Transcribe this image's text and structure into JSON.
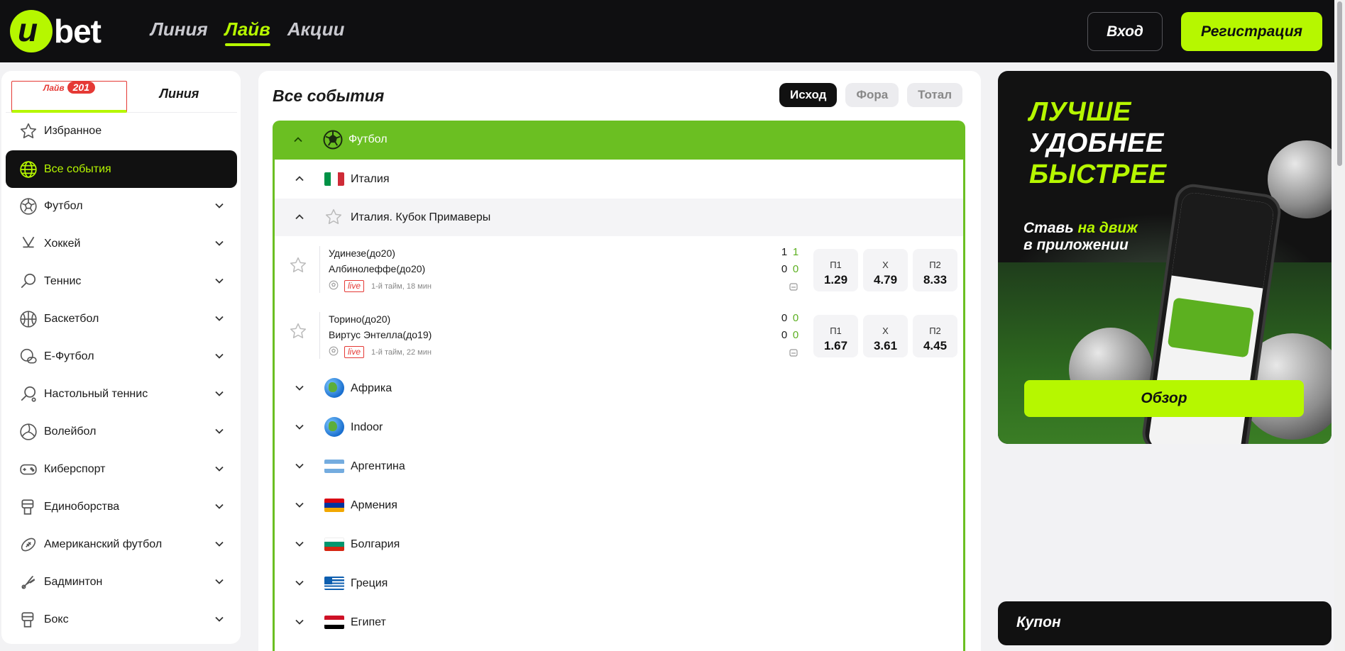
{
  "brand": {
    "logo_u": "u",
    "logo_bet": "bet",
    "accent": "#b6f700"
  },
  "nav": {
    "line": "Линия",
    "live": "Лайв",
    "promos": "Акции"
  },
  "auth": {
    "login": "Вход",
    "register": "Регистрация"
  },
  "sidebar": {
    "tab_live": "Лайв",
    "live_count": "201",
    "tab_line": "Линия",
    "items": [
      {
        "label": "Избранное",
        "icon": "star-icon"
      },
      {
        "label": "Все события",
        "icon": "globe-icon"
      },
      {
        "label": "Футбол",
        "icon": "football-icon"
      },
      {
        "label": "Хоккей",
        "icon": "hockey-icon"
      },
      {
        "label": "Теннис",
        "icon": "tennis-icon"
      },
      {
        "label": "Баскетбол",
        "icon": "basketball-icon"
      },
      {
        "label": "E-Футбол",
        "icon": "efootball-icon"
      },
      {
        "label": "Настольный теннис",
        "icon": "table-tennis-icon"
      },
      {
        "label": "Волейбол",
        "icon": "volleyball-icon"
      },
      {
        "label": "Киберспорт",
        "icon": "gamepad-icon"
      },
      {
        "label": "Единоборства",
        "icon": "martial-arts-icon"
      },
      {
        "label": "Американский футбол",
        "icon": "american-football-icon"
      },
      {
        "label": "Бадминтон",
        "icon": "badminton-icon"
      },
      {
        "label": "Бокс",
        "icon": "boxing-icon"
      }
    ]
  },
  "main": {
    "title": "Все события",
    "tabs": [
      "Исход",
      "Фора",
      "Тотал"
    ],
    "sport": "Футбол",
    "country": "Италия",
    "league": "Италия. Кубок Примаверы",
    "matches": [
      {
        "team1": "Удинезе(до20)",
        "team2": "Албинолеффе(до20)",
        "live": "live",
        "period": "1-й тайм, 18 мин",
        "score1": "1",
        "score1_half": "1",
        "score2": "0",
        "score2_half": "0",
        "odds": [
          {
            "label": "П1",
            "value": "1.29"
          },
          {
            "label": "Х",
            "value": "4.79"
          },
          {
            "label": "П2",
            "value": "8.33"
          }
        ]
      },
      {
        "team1": "Торино(до20)",
        "team2": "Виртус Энтелла(до19)",
        "live": "live",
        "period": "1-й тайм, 22 мин",
        "score1": "0",
        "score1_half": "0",
        "score2": "0",
        "score2_half": "0",
        "odds": [
          {
            "label": "П1",
            "value": "1.67"
          },
          {
            "label": "Х",
            "value": "3.61"
          },
          {
            "label": "П2",
            "value": "4.45"
          }
        ]
      }
    ],
    "regions": [
      "Африка",
      "Indoor",
      "Аргентина",
      "Армения",
      "Болгария",
      "Греция",
      "Египет"
    ]
  },
  "promo": {
    "line1": "ЛУЧШЕ",
    "line2": "УДОБНЕЕ",
    "line3": "БЫСТРЕЕ",
    "sub_part1": "Ставь ",
    "sub_highlight": "на движ",
    "sub_part2": "в приложении",
    "button": "Обзор"
  },
  "coupon": {
    "label": "Купон"
  }
}
